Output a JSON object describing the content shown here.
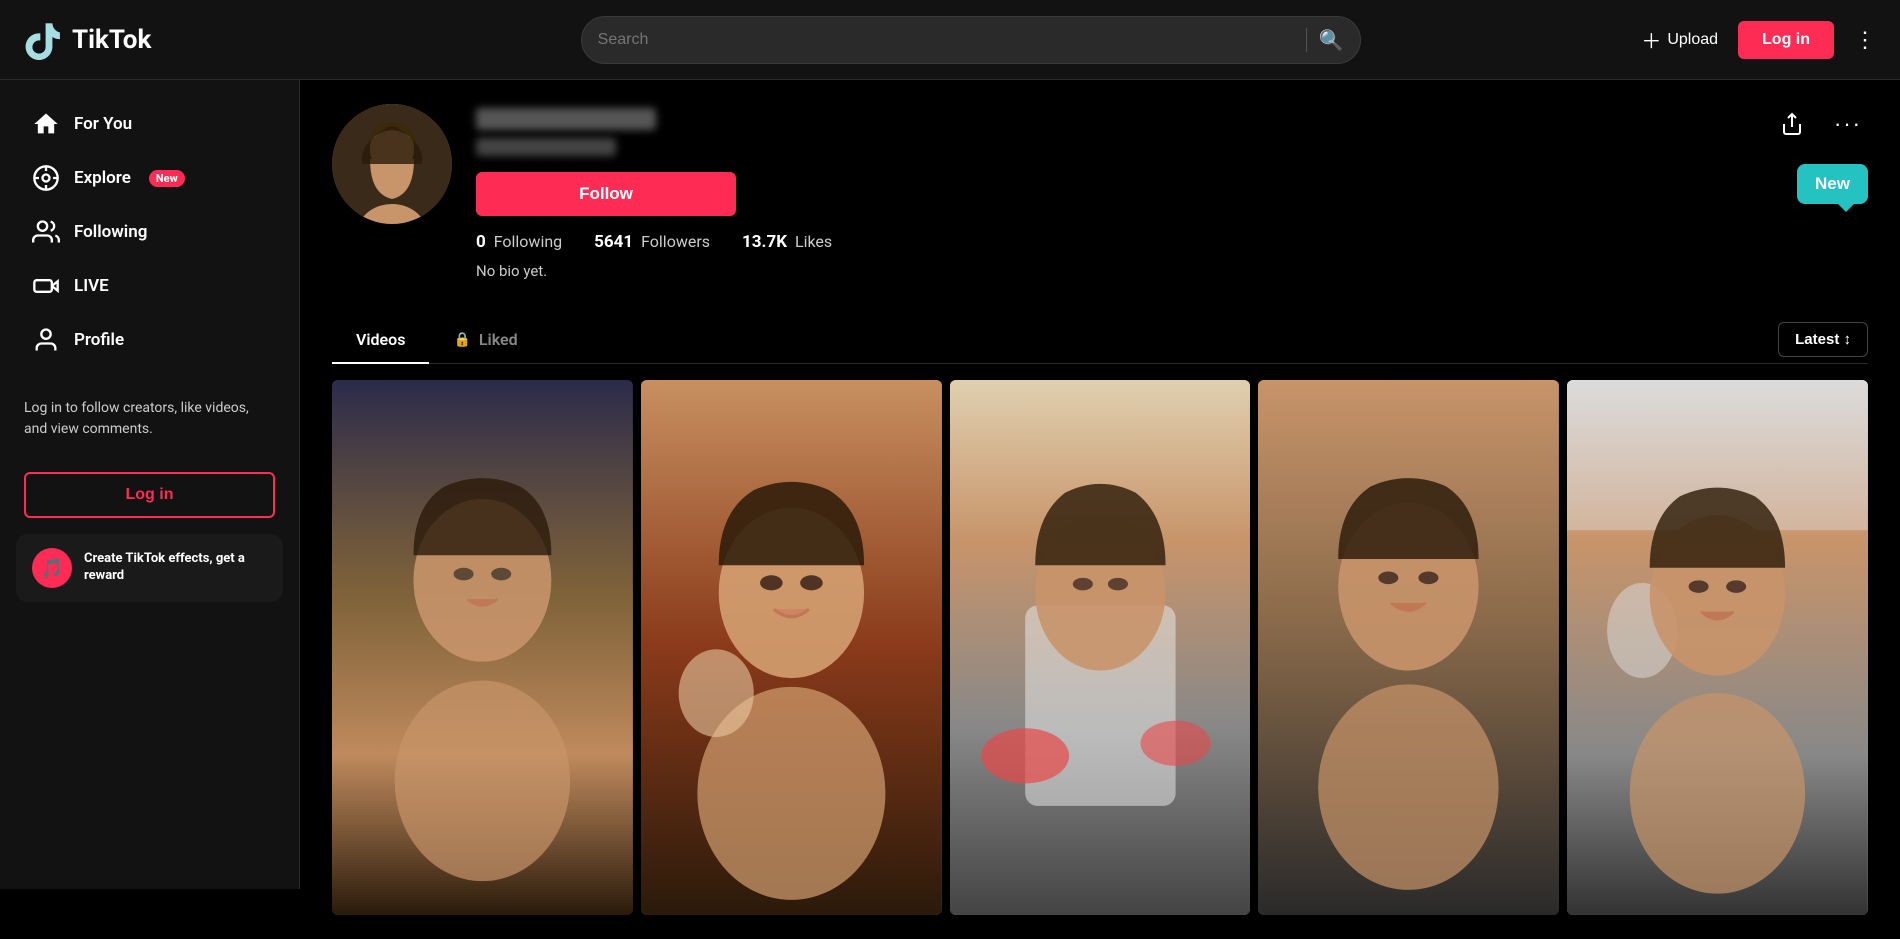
{
  "header": {
    "logo_text": "TikTok",
    "search_placeholder": "Search",
    "upload_label": "Upload",
    "login_label": "Log in",
    "more_icon": "⋮"
  },
  "sidebar": {
    "nav_items": [
      {
        "id": "for-you",
        "label": "For You",
        "icon": "home"
      },
      {
        "id": "explore",
        "label": "Explore",
        "icon": "compass",
        "badge": "New"
      },
      {
        "id": "following",
        "label": "Following",
        "icon": "people"
      },
      {
        "id": "live",
        "label": "LIVE",
        "icon": "live"
      },
      {
        "id": "profile",
        "label": "Profile",
        "icon": "person"
      }
    ],
    "login_prompt": "Log in to follow creators, like videos, and view comments.",
    "login_button_label": "Log in",
    "effects_banner": {
      "text": "Create TikTok effects, get a reward"
    }
  },
  "profile": {
    "username_placeholder": "username",
    "handle_placeholder": "handle",
    "follow_button_label": "Follow",
    "stats": {
      "following_count": "0",
      "following_label": "Following",
      "followers_count": "5641",
      "followers_label": "Followers",
      "likes_count": "13.7K",
      "likes_label": "Likes"
    },
    "bio": "No bio yet.",
    "share_icon": "share",
    "more_icon": "more",
    "new_button_label": "New"
  },
  "tabs": {
    "videos_label": "Videos",
    "liked_label": "Liked",
    "active_tab": "videos",
    "sort_label": "Latest ↕"
  },
  "videos": [
    {
      "id": 1,
      "thumb_class": "thumb-1"
    },
    {
      "id": 2,
      "thumb_class": "thumb-2"
    },
    {
      "id": 3,
      "thumb_class": "thumb-3"
    },
    {
      "id": 4,
      "thumb_class": "thumb-4"
    },
    {
      "id": 5,
      "thumb_class": "thumb-5"
    }
  ],
  "colors": {
    "accent": "#fe2c55",
    "teal": "#25c2c2",
    "bg_dark": "#121212",
    "bg_black": "#000000"
  }
}
